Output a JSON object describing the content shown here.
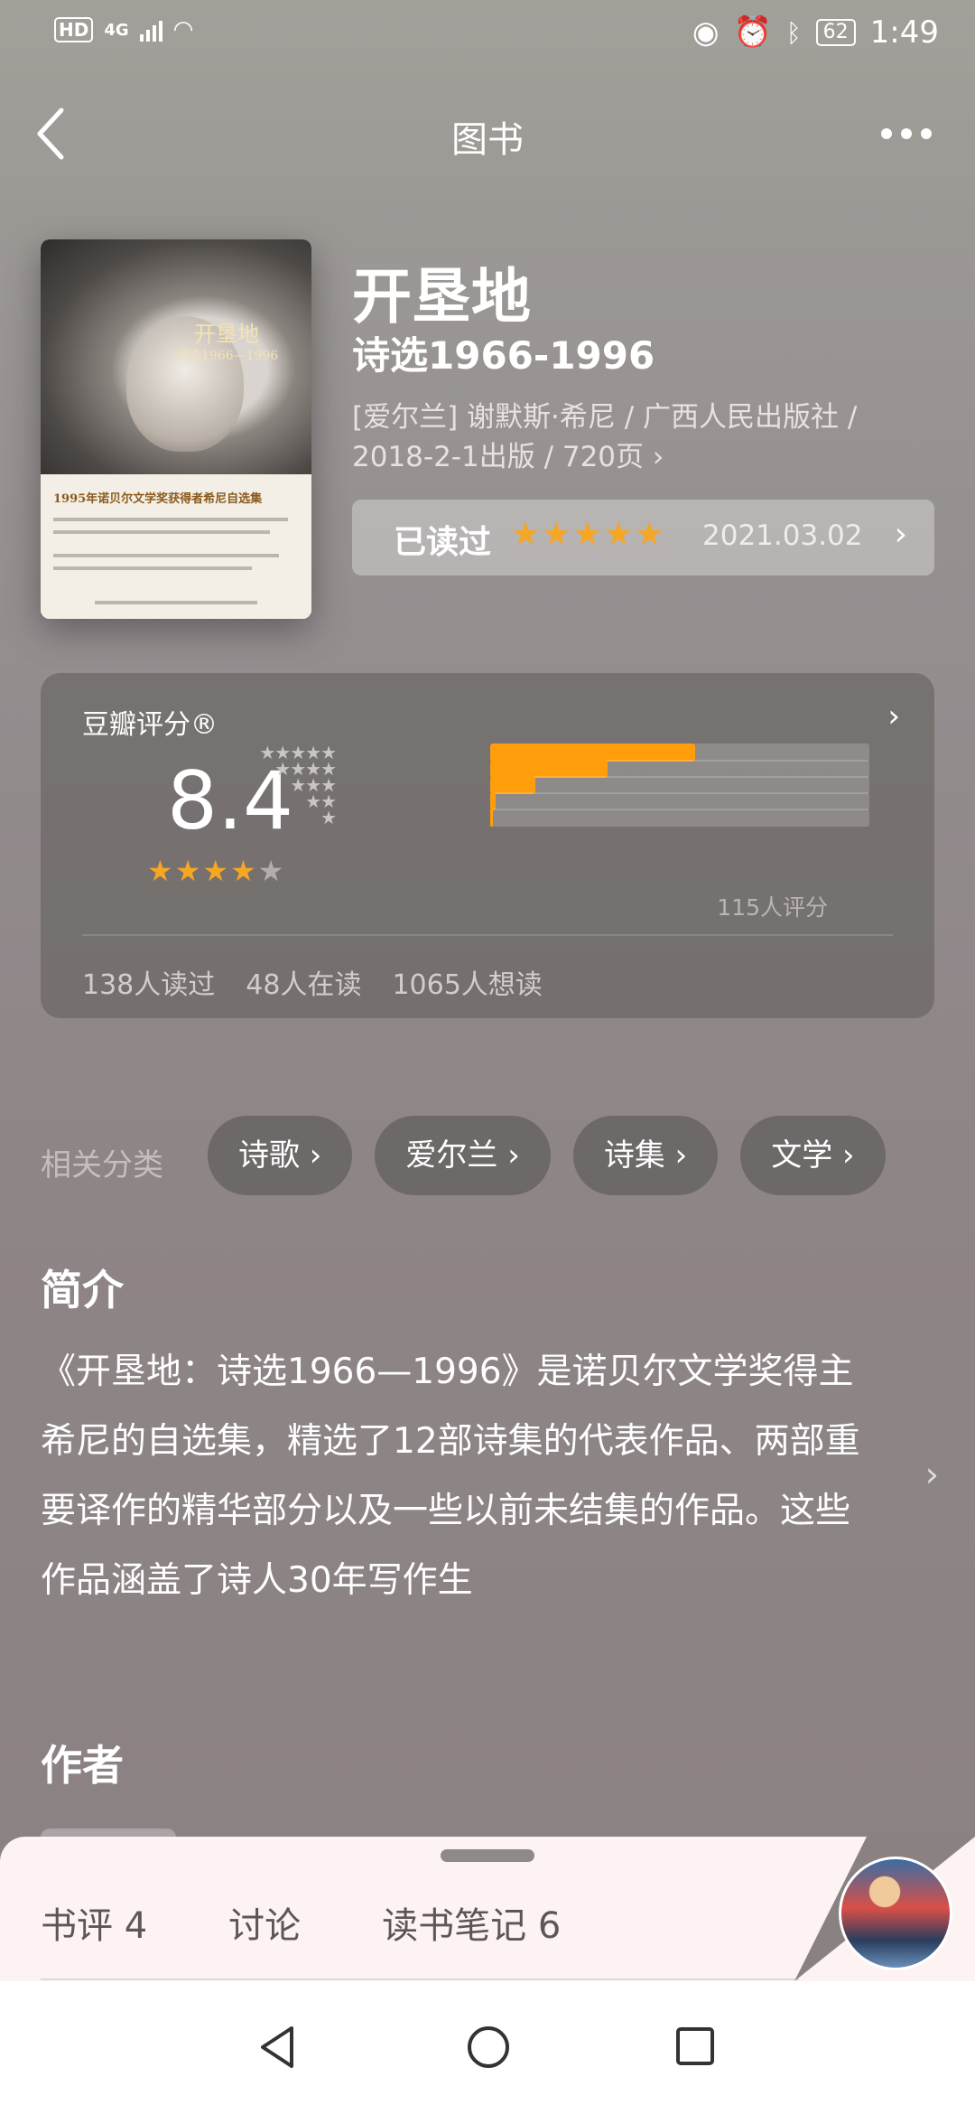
{
  "status": {
    "hd": "HD",
    "network": "4G",
    "battery": "62",
    "time": "1:49"
  },
  "header": {
    "title": "图书"
  },
  "book": {
    "cover_title": "开垦地",
    "cover_subtitle": "诗选1966—1996",
    "cover_band_text": "1995年诺贝尔文学奖获得者希尼自选集",
    "name": "开垦地",
    "subtitle": "诗选1966-1996",
    "meta_line1": "[爱尔兰] 谢默斯·希尼 / 广西人民出版社 /",
    "meta_line2": "2018-2-1出版 / 720页 ›",
    "read_status": "已读过",
    "read_stars": "★★★★★",
    "read_date": "2021.03.02",
    "chevron": "›"
  },
  "rating": {
    "label": "豆瓣评分®",
    "score": "8.4",
    "stars_on": "★★★★",
    "stars_off": "★",
    "distribution": [
      {
        "stars": "★★★★★",
        "fraction": 0.54
      },
      {
        "stars": "★★★★",
        "fraction": 0.31
      },
      {
        "stars": "★★★",
        "fraction": 0.12
      },
      {
        "stars": "★★",
        "fraction": 0.015
      },
      {
        "stars": "★",
        "fraction": 0.008
      }
    ],
    "count": "115人评分",
    "read": "138人读过",
    "reading": "48人在读",
    "want": "1065人想读"
  },
  "tags": {
    "label": "相关分类",
    "items": [
      "诗歌 ›",
      "爱尔兰 ›",
      "诗集 ›",
      "文学 ›"
    ]
  },
  "intro": {
    "heading": "简介",
    "text": "《开垦地：诗选1966—1996》是诺贝尔文学奖得主希尼的自选集，精选了12部诗集的代表作品、两部重要译作的精华部分以及一些以前未结集的作品。这些作品涵盖了诗人30年写作生"
  },
  "author": {
    "heading": "作者"
  },
  "bottom": {
    "tabs": [
      "书评 4",
      "讨论",
      "读书笔记 6"
    ]
  },
  "colors": {
    "accent": "#f5a623",
    "bar": "#ff9e0a"
  }
}
